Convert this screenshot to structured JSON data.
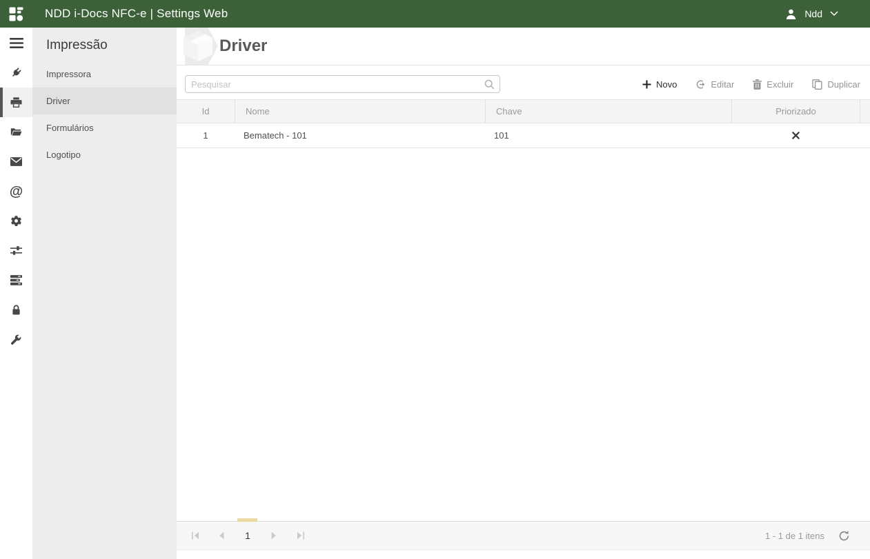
{
  "colors": {
    "topbar_green": "#3C6139",
    "pager_highlight_yellow": "#EBD9A2"
  },
  "topbar": {
    "title": "NDD i-Docs NFC-e | Settings Web",
    "user_name": "Ndd"
  },
  "iconbar": {
    "items": [
      "menu",
      "plug",
      "printer",
      "folder-open",
      "envelope",
      "at-sign",
      "gear",
      "sliders",
      "server-stack",
      "lock",
      "wrench"
    ],
    "active_item": "printer"
  },
  "sidebar": {
    "heading": "Impressão",
    "items": [
      {
        "label": "Impressora",
        "active": false
      },
      {
        "label": "Driver",
        "active": true
      },
      {
        "label": "Formulários",
        "active": false
      },
      {
        "label": "Logotipo",
        "active": false
      }
    ]
  },
  "page": {
    "title": "Driver"
  },
  "toolbar": {
    "search": {
      "placeholder": "Pesquisar",
      "value": ""
    },
    "buttons": [
      {
        "label": "Novo",
        "icon": "plus-icon",
        "enabled": true
      },
      {
        "label": "Editar",
        "icon": "edit-icon",
        "enabled": false
      },
      {
        "label": "Excluir",
        "icon": "trash-icon",
        "enabled": false
      },
      {
        "label": "Duplicar",
        "icon": "duplicate-icon",
        "enabled": false
      }
    ]
  },
  "table": {
    "columns": [
      "Id",
      "Nome",
      "Chave",
      "Priorizado"
    ],
    "rows": [
      {
        "id": "1",
        "nome": "Bematech - 101",
        "chave": "101",
        "priorizado": false
      }
    ]
  },
  "pager": {
    "current_page": "1",
    "info": "1 - 1 de 1 itens"
  }
}
